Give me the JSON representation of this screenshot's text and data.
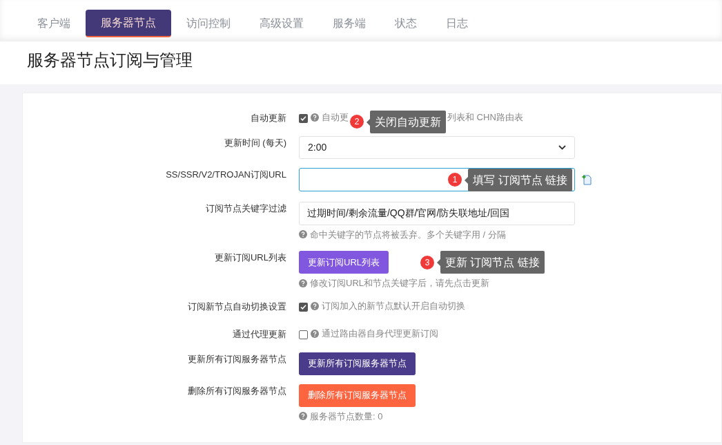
{
  "tabs": [
    {
      "label": "客户端",
      "selected": false
    },
    {
      "label": "服务器节点",
      "selected": true
    },
    {
      "label": "访问控制",
      "selected": false
    },
    {
      "label": "高级设置",
      "selected": false
    },
    {
      "label": "服务端",
      "selected": false
    },
    {
      "label": "状态",
      "selected": false
    },
    {
      "label": "日志",
      "selected": false
    }
  ],
  "heading": "服务器节点订阅与管理",
  "rows": [
    {
      "kind": "checkbox",
      "label": "自动更新",
      "checked": true,
      "help": "自动更",
      "help_end": "列表和 CHN路由表",
      "annotation": {
        "number": "2",
        "text": "关闭自动更新"
      }
    },
    {
      "kind": "select",
      "label": "更新时间 (每天)",
      "value": "2:00"
    },
    {
      "kind": "input",
      "label": "SS/SSR/V2/TROJAN订阅URL",
      "focused": true,
      "annotation": {
        "number": "1",
        "text": "填写 订阅节点 链接"
      }
    },
    {
      "kind": "input",
      "label": "订阅节点关键字过滤",
      "value": "过期时间/剩余流量/QQ群/官网/防失联地址/回国",
      "help": "命中关键字的节点将被丢弃。多个关键字用 / 分隔"
    },
    {
      "kind": "button",
      "label": "更新订阅URL列表",
      "button": "更新订阅URL列表",
      "color": "#8257e0",
      "help": "修改订阅URL和节点关键字后，请先点击更新",
      "annotation": {
        "number": "3",
        "text": "更新 订阅节点 链接"
      }
    },
    {
      "kind": "checkbox",
      "label": "订阅新节点自动切换设置",
      "checked": true,
      "help": "订阅加入的新节点默认开启自动切换"
    },
    {
      "kind": "checkbox",
      "label": "通过代理更新",
      "checked": false,
      "help": "通过路由器自身代理更新订阅"
    },
    {
      "kind": "button",
      "label": "更新所有订阅服务器节点",
      "button": "更新所有订阅服务器节点",
      "color": "#4b3c8b"
    },
    {
      "kind": "button",
      "label": "删除所有订阅服务器节点",
      "button": "删除所有订阅服务器节点",
      "color": "#fd6440",
      "help": "服务器节点数量: 0"
    }
  ]
}
